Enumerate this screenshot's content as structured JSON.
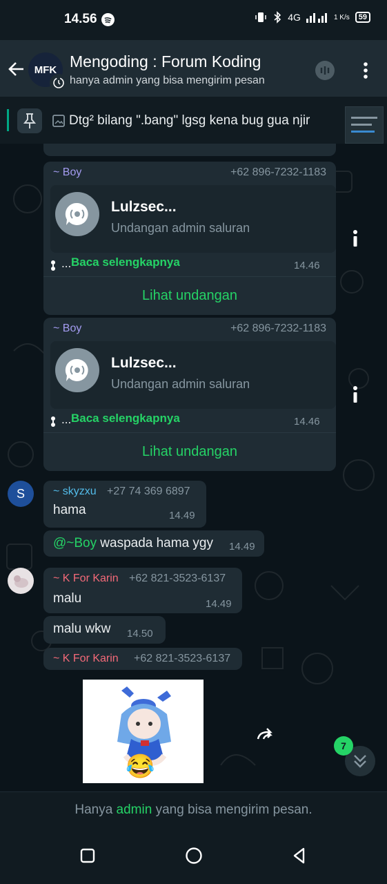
{
  "status": {
    "time": "14.56",
    "network": "4G",
    "speed": "1 K/s",
    "battery": "59"
  },
  "header": {
    "avatar_text": "MFK",
    "title": "Mengoding : Forum Koding",
    "subtitle": "hanya admin yang bisa mengirim pesan"
  },
  "pinned": {
    "text": "Dtg² bilang \".bang\" lgsg kena bug gua njir"
  },
  "messages": [
    {
      "type": "invite",
      "sender": "~ Boy",
      "phone": "+62 896-7232-1183",
      "channel": "Lulzsec...",
      "subtitle": "Undangan admin saluran",
      "read_more": "Baca selengkapnya",
      "time": "14.46",
      "action": "Lihat undangan"
    },
    {
      "type": "invite",
      "sender": "~ Boy",
      "phone": "+62 896-7232-1183",
      "channel": "Lulzsec...",
      "subtitle": "Undangan admin saluran",
      "read_more": "Baca selengkapnya",
      "time": "14.46",
      "action": "Lihat undangan"
    },
    {
      "type": "text",
      "avatar": "S",
      "sender": "~ skyzxu",
      "phone": "+27 74 369 6897",
      "text": "hama",
      "time": "14.49"
    },
    {
      "type": "text",
      "mention": "@~Boy",
      "text": " waspada hama ygy",
      "time": "14.49"
    },
    {
      "type": "text",
      "sender": "~ K For Karin",
      "phone": "+62 821-3523-6137",
      "text": "malu",
      "time": "14.49"
    },
    {
      "type": "text",
      "text": "malu wkw",
      "time": "14.50"
    },
    {
      "type": "sticker",
      "sender": "~ K For Karin",
      "phone": "+62 821-3523-6137",
      "emoji": "😂"
    }
  ],
  "unread_count": "7",
  "footer": {
    "prefix": "Hanya ",
    "highlight": "admin",
    "suffix": " yang bisa mengirim pesan."
  },
  "colors": {
    "accent": "#25d366",
    "bubble": "#1f2c34",
    "background": "#0b141a"
  }
}
